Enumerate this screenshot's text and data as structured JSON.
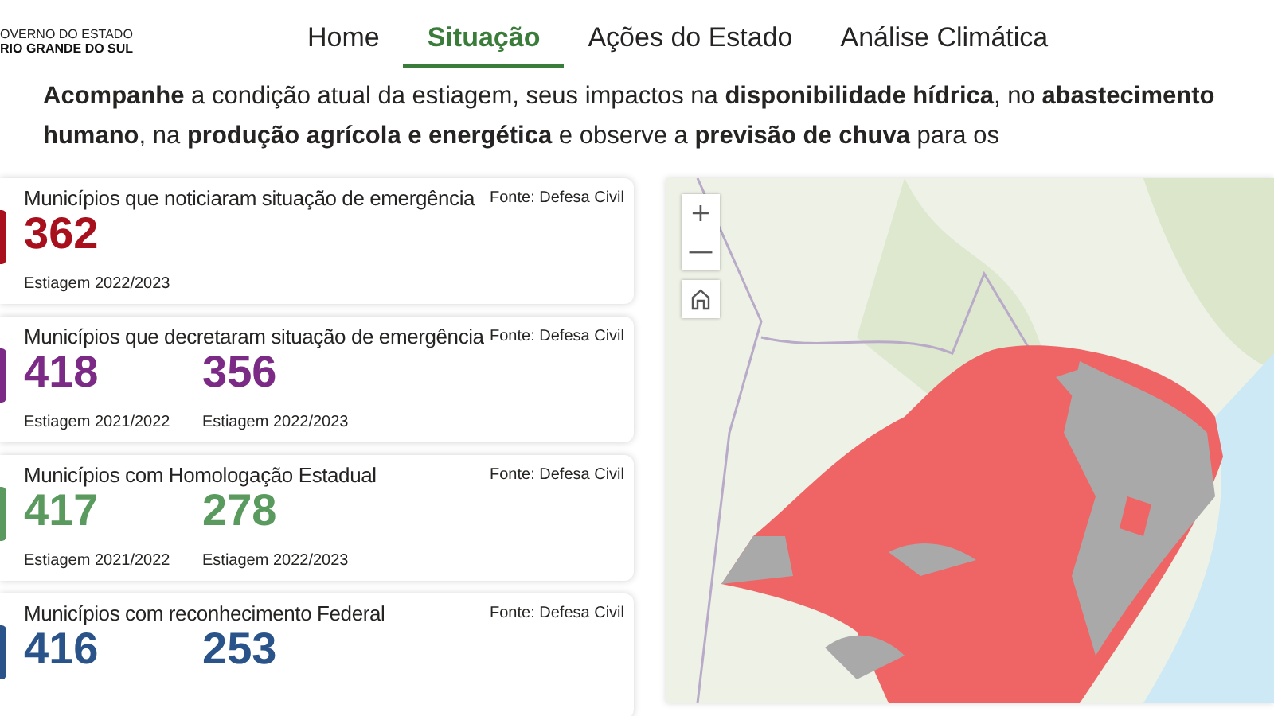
{
  "logo": {
    "line_1": "OVERNO DO ESTADO",
    "line_2": "RIO GRANDE DO SUL"
  },
  "nav": [
    {
      "label": "Home",
      "selected": false
    },
    {
      "label": "Situação",
      "selected": true
    },
    {
      "label": "Ações do Estado",
      "selected": false
    },
    {
      "label": "Análise Climática",
      "selected": false
    }
  ],
  "intro": "**Acompanhe**  a condição atual da estiagem, seus impactos na **disponibilidade hídrica**, no **abastecimento humano**, na **produção agrícola e energética** e observe a **previsão de chuva** para os",
  "cards": [
    {
      "title": "Municípios que noticiaram situação de emergência",
      "source": "Fonte: Defesa Civil",
      "color": "#a8101e",
      "values": [
        {
          "number": "362",
          "label": "Estiagem 2022/2023"
        }
      ]
    },
    {
      "title": "Municípios que decretaram situação de emergência",
      "source": "Fonte: Defesa Civil",
      "color": "#7b2a86",
      "values": [
        {
          "number": "418",
          "label": "Estiagem 2021/2022"
        },
        {
          "number": "356",
          "label": "Estiagem 2022/2023"
        }
      ]
    },
    {
      "title": "Municípios com Homologação Estadual",
      "source": "Fonte: Defesa Civil",
      "color": "#5a9a5e",
      "values": [
        {
          "number": "417",
          "label": "Estiagem 2021/2022"
        },
        {
          "number": "278",
          "label": "Estiagem 2022/2023"
        }
      ]
    },
    {
      "title": "Municípios com reconhecimento Federal",
      "source": "Fonte: Defesa Civil",
      "color": "#2a5489",
      "values": [
        {
          "number": "416"
        },
        {
          "number": "253"
        }
      ]
    }
  ],
  "map": {
    "kind": "picture",
    "zoom_in": "+",
    "zoom_out": "—"
  }
}
